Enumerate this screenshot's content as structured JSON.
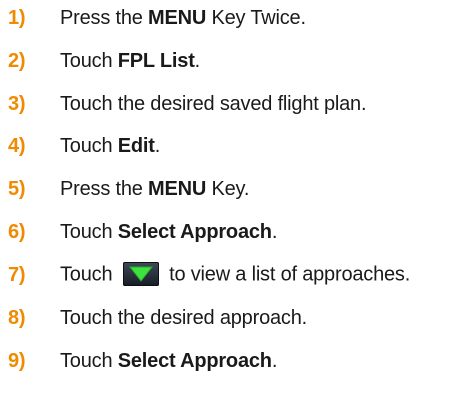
{
  "steps": [
    {
      "number": "1)",
      "pre": "Press the ",
      "bold": "MENU",
      "post": " Key Twice."
    },
    {
      "number": "2)",
      "pre": "Touch ",
      "bold": "FPL List",
      "post": "."
    },
    {
      "number": "3)",
      "pre": "Touch the desired saved flight plan.",
      "bold": "",
      "post": ""
    },
    {
      "number": "4)",
      "pre": "Touch ",
      "bold": "Edit",
      "post": "."
    },
    {
      "number": "5)",
      "pre": "Press the ",
      "bold": "MENU",
      "post": " Key."
    },
    {
      "number": "6)",
      "pre": "Touch ",
      "bold": "Select Approach",
      "post": "."
    },
    {
      "number": "7)",
      "pre": "Touch ",
      "icon": "green-down-arrow-icon",
      "post": " to view a list of approaches."
    },
    {
      "number": "8)",
      "pre": "Touch the desired approach.",
      "bold": "",
      "post": ""
    },
    {
      "number": "9)",
      "pre": "Touch ",
      "bold": "Select Approach",
      "post": "."
    }
  ],
  "colors": {
    "step_number": "#f08a00",
    "text": "#1a1a1a",
    "icon_background": "#222a33",
    "icon_arrow": "#3fe13f"
  }
}
